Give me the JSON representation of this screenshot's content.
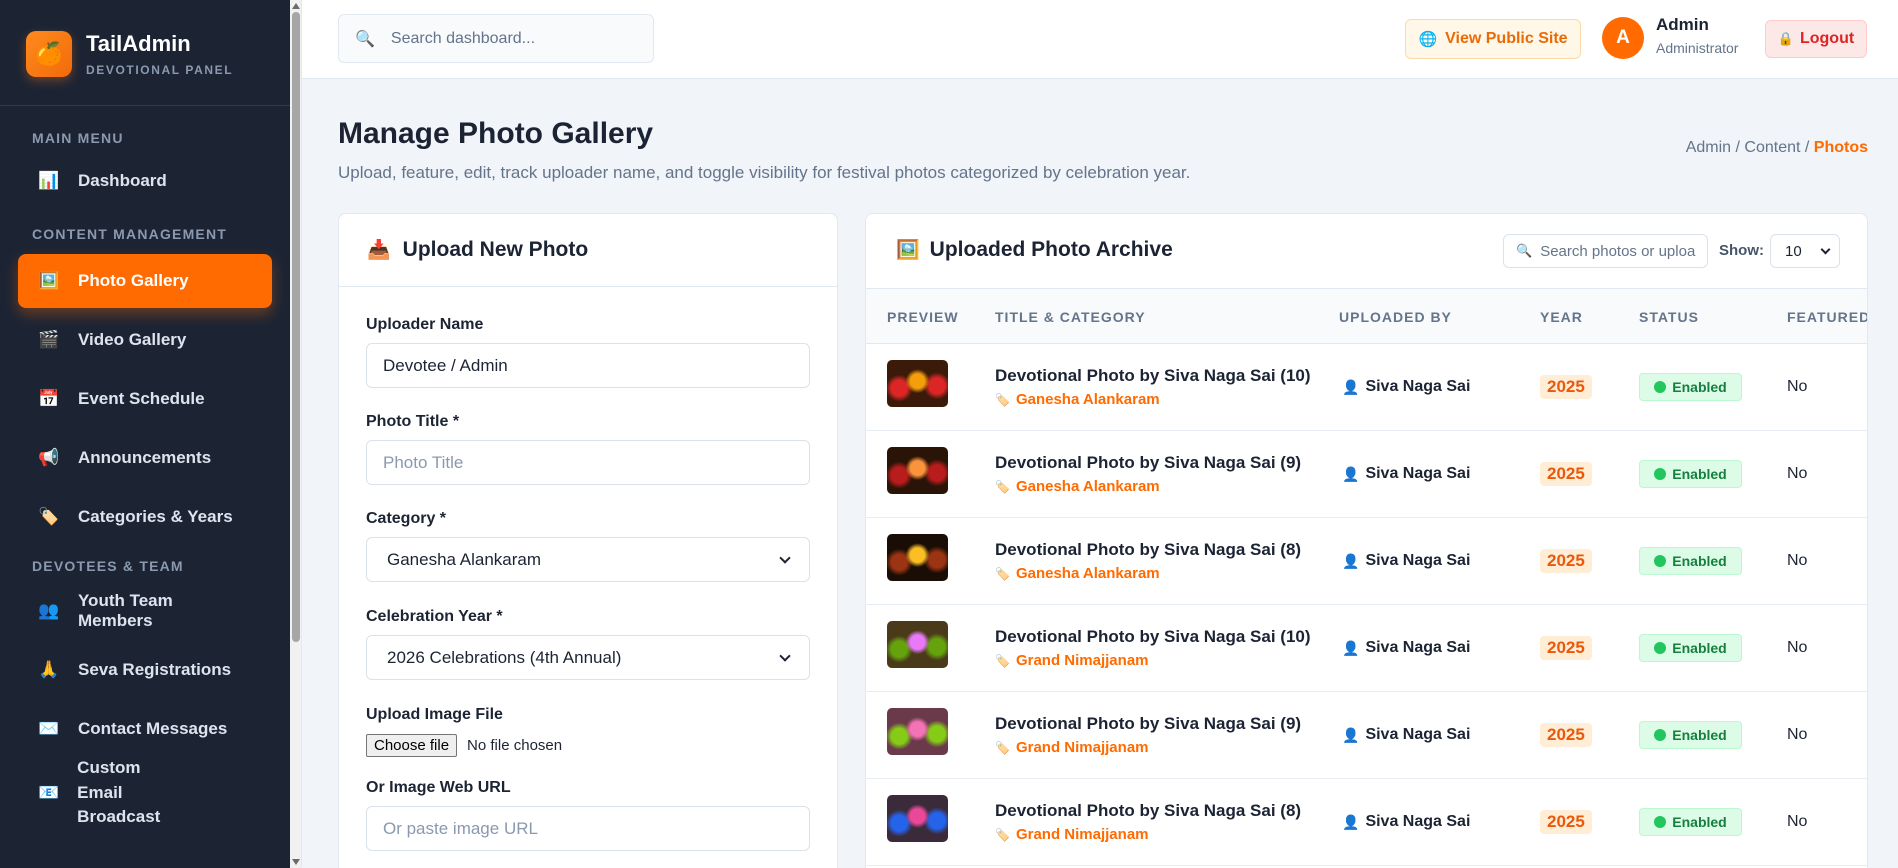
{
  "brand": {
    "title": "TailAdmin",
    "subtitle": "DEVOTIONAL PANEL",
    "logo_icon": "orange-fruit-icon"
  },
  "sidebar": {
    "sections": [
      {
        "label": "MAIN MENU"
      },
      {
        "label": "CONTENT MANAGEMENT"
      },
      {
        "label": "DEVOTEES & TEAM"
      }
    ],
    "items": [
      {
        "label": "Dashboard",
        "icon": "bar-chart-icon",
        "active": false
      },
      {
        "label": "Photo Gallery",
        "icon": "image-icon",
        "active": true
      },
      {
        "label": "Video Gallery",
        "icon": "clapper-icon",
        "active": false
      },
      {
        "label": "Event Schedule",
        "icon": "calendar-icon",
        "active": false
      },
      {
        "label": "Announcements",
        "icon": "megaphone-icon",
        "active": false
      },
      {
        "label": "Categories & Years",
        "icon": "tag-icon",
        "active": false
      },
      {
        "label": "Youth Team Members",
        "icon": "people-icon",
        "active": false
      },
      {
        "label": "Seva Registrations",
        "icon": "folded-hands-icon",
        "active": false
      },
      {
        "label": "Contact Messages",
        "icon": "envelope-icon",
        "active": false
      },
      {
        "label": "Custom Email Broadcast",
        "icon": "mail-broadcast-icon",
        "active": false
      }
    ]
  },
  "topbar": {
    "search_placeholder": "Search dashboard...",
    "view_site_label": "View Public Site",
    "avatar_initial": "A",
    "admin_name": "Admin",
    "admin_role": "Administrator",
    "logout_label": "Logout"
  },
  "page": {
    "title": "Manage Photo Gallery",
    "description": "Upload, feature, edit, track uploader name, and toggle visibility for festival photos categorized by celebration year.",
    "breadcrumb": {
      "a": "Admin",
      "sep": " / ",
      "b": "Content",
      "current": "Photos"
    }
  },
  "upload_form": {
    "title": "Upload New Photo",
    "uploader_label": "Uploader Name",
    "uploader_value": "Devotee / Admin",
    "photo_title_label": "Photo Title *",
    "photo_title_placeholder": "Photo Title",
    "category_label": "Category *",
    "category_value": "Ganesha Alankaram",
    "year_label": "Celebration Year *",
    "year_value": "2026 Celebrations (4th Annual)",
    "file_label": "Upload Image File",
    "file_button": "Choose file",
    "file_status": "No file chosen",
    "url_label": "Or Image Web URL",
    "url_placeholder": "Or paste image URL"
  },
  "archive": {
    "title": "Uploaded Photo Archive",
    "search_placeholder": "Search photos or uploa",
    "show_label": "Show:",
    "show_value": "10",
    "columns": [
      "PREVIEW",
      "TITLE & CATEGORY",
      "UPLOADED BY",
      "YEAR",
      "STATUS",
      "FEATURED"
    ],
    "rows": [
      {
        "title": "Devotional Photo by Siva Naga Sai (10)",
        "category": "Ganesha Alankaram",
        "uploader": "Siva Naga Sai",
        "year": "2025",
        "status": "Enabled",
        "featured": "No",
        "thumb_colors": [
          "#3b1a0a",
          "#f59e0b",
          "#dc2626"
        ]
      },
      {
        "title": "Devotional Photo by Siva Naga Sai (9)",
        "category": "Ganesha Alankaram",
        "uploader": "Siva Naga Sai",
        "year": "2025",
        "status": "Enabled",
        "featured": "No",
        "thumb_colors": [
          "#2a1407",
          "#fb923c",
          "#b91c1c"
        ]
      },
      {
        "title": "Devotional Photo by Siva Naga Sai (8)",
        "category": "Ganesha Alankaram",
        "uploader": "Siva Naga Sai",
        "year": "2025",
        "status": "Enabled",
        "featured": "No",
        "thumb_colors": [
          "#1a0d05",
          "#fbbf24",
          "#9a3412"
        ]
      },
      {
        "title": "Devotional Photo by Siva Naga Sai (10)",
        "category": "Grand Nimajjanam",
        "uploader": "Siva Naga Sai",
        "year": "2025",
        "status": "Enabled",
        "featured": "No",
        "thumb_colors": [
          "#4a3a1a",
          "#e879f9",
          "#65a30d"
        ]
      },
      {
        "title": "Devotional Photo by Siva Naga Sai (9)",
        "category": "Grand Nimajjanam",
        "uploader": "Siva Naga Sai",
        "year": "2025",
        "status": "Enabled",
        "featured": "No",
        "thumb_colors": [
          "#6b3a4a",
          "#f472b6",
          "#84cc16"
        ]
      },
      {
        "title": "Devotional Photo by Siva Naga Sai (8)",
        "category": "Grand Nimajjanam",
        "uploader": "Siva Naga Sai",
        "year": "2025",
        "status": "Enabled",
        "featured": "No",
        "thumb_colors": [
          "#3a2a3a",
          "#ec4899",
          "#2563eb"
        ]
      }
    ]
  }
}
